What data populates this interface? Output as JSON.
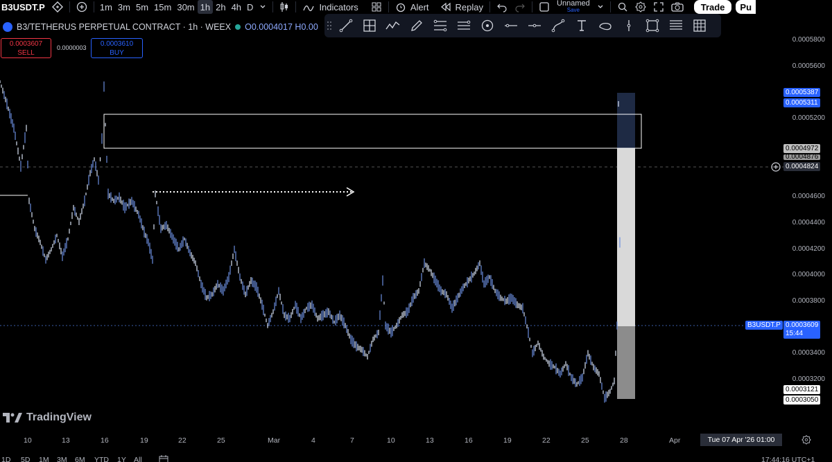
{
  "toolbar": {
    "symbol": "B3USDT.P",
    "timeframes": [
      {
        "label": "1m",
        "active": false
      },
      {
        "label": "3m",
        "active": false
      },
      {
        "label": "5m",
        "active": false
      },
      {
        "label": "15m",
        "active": false
      },
      {
        "label": "30m",
        "active": false
      },
      {
        "label": "1h",
        "active": true
      },
      {
        "label": "2h",
        "active": false
      },
      {
        "label": "4h",
        "active": false
      },
      {
        "label": "D",
        "active": false
      }
    ],
    "indicators_label": "Indicators",
    "alert_label": "Alert",
    "replay_label": "Replay",
    "layout_name": "Unnamed",
    "layout_save": "Save",
    "trade_label": "Trade",
    "publish_label": "Pu"
  },
  "legend": {
    "title": "B3/TETHERUS PERPETUAL CONTRACT · 1h · WEEX",
    "open_label": "O",
    "open_value": "0.0004017",
    "high_label": "H",
    "high_value": "0.00"
  },
  "order_panel": {
    "sell_price": "0.0003607",
    "sell_label": "SELL",
    "spread": "0.0000003",
    "buy_price": "0.0003610",
    "buy_label": "BUY"
  },
  "drawing_tools": [
    "trend-line-icon",
    "cross-grid-icon",
    "zigzag-icon",
    "brush-icon",
    "fib-icon",
    "channel-icon",
    "circle-icon",
    "ray-icon",
    "horizontal-ray-icon",
    "curve-icon",
    "text-icon",
    "shape-icon",
    "vertical-line-icon",
    "rectangle-icon",
    "long-position-icon",
    "table-icon"
  ],
  "price_axis": {
    "ticks": [
      "0.0005800",
      "0.0005600",
      "0.0005200",
      "0.0004600",
      "0.0004400",
      "0.0004200",
      "0.0004000",
      "0.0003800",
      "0.0003400",
      "0.0003200"
    ],
    "tags": {
      "target_high": "0.0005387",
      "target_low": "0.0005311",
      "entry_a": "0.0004972",
      "entry_b": "0.0004876",
      "crosshair": "0.0004824",
      "symbol_tag": "B3USDT.P",
      "last_price": "0.0003609",
      "countdown": "15:44",
      "stop_a": "0.0003121",
      "stop_b": "0.0003050"
    }
  },
  "time_axis": {
    "labels": [
      "10",
      "13",
      "16",
      "19",
      "22",
      "25",
      "Mar",
      "4",
      "7",
      "10",
      "13",
      "16",
      "19",
      "22",
      "25",
      "28",
      "Apr"
    ],
    "crosshair_label": "Tue 07 Apr '26   01:00"
  },
  "bottom_bar": {
    "ranges": [
      "1D",
      "5D",
      "1M",
      "3M",
      "6M",
      "YTD",
      "1Y",
      "All"
    ],
    "clock": "17:44:16 UTC+1"
  },
  "watermark": "TradingView",
  "colors": {
    "accent": "#2962ff",
    "candle": "#5b7fd6",
    "sell": "#f23645",
    "background": "#000000"
  }
}
